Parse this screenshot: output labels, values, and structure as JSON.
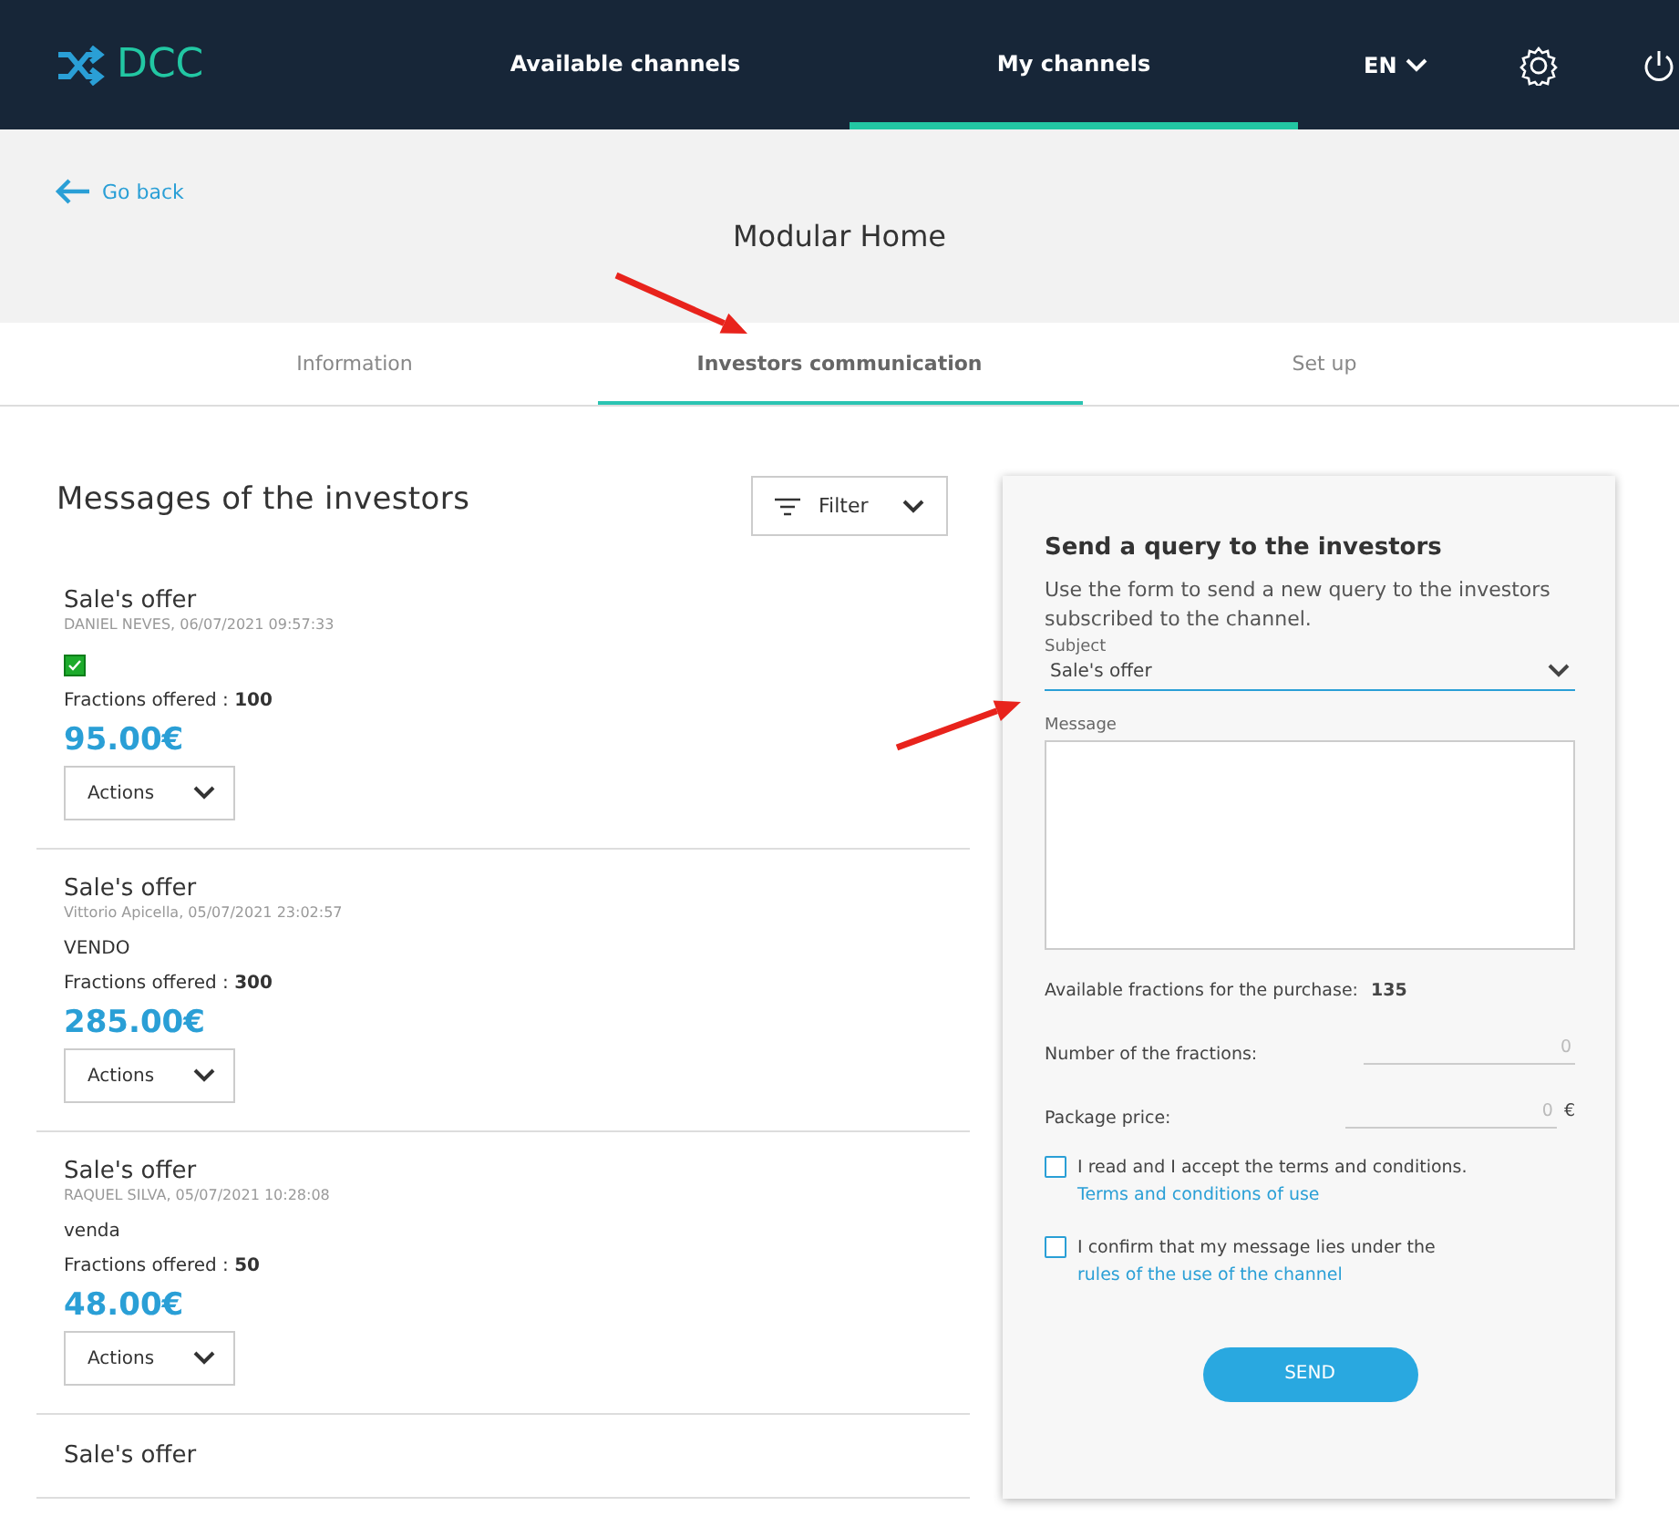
{
  "header": {
    "logo": "DCC",
    "nav": [
      {
        "label": "Available channels",
        "selected": false
      },
      {
        "label": "My channels",
        "selected": true
      }
    ],
    "language": "EN"
  },
  "page": {
    "back": "Go back",
    "title": "Modular Home"
  },
  "tabs": [
    {
      "label": "Information",
      "selected": false
    },
    {
      "label": "Investors communication",
      "selected": true
    },
    {
      "label": "Set up",
      "selected": false
    }
  ],
  "messages": {
    "title": "Messages of the investors",
    "filter": "Filter",
    "items": [
      {
        "title": "Sale's offer",
        "meta": "DANIEL NEVES, 06/07/2021 09:57:33",
        "kind": "check",
        "checked": true,
        "fractions_label": "Fractions offered :",
        "fractions": "100",
        "price": "95.00€",
        "action": "Actions"
      },
      {
        "title": "Sale's offer",
        "meta": "Vittorio Apicella, 05/07/2021 23:02:57",
        "kind": "text",
        "body": "VENDO",
        "fractions_label": "Fractions offered :",
        "fractions": "300",
        "price": "285.00€",
        "action": "Actions"
      },
      {
        "title": "Sale's offer",
        "meta": "RAQUEL SILVA, 05/07/2021 10:28:08",
        "kind": "text",
        "body": "venda",
        "fractions_label": "Fractions offered :",
        "fractions": "50",
        "price": "48.00€",
        "action": "Actions"
      },
      {
        "title": "Sale's offer",
        "kind": "partial"
      }
    ]
  },
  "query": {
    "title": "Send a query to the investors",
    "intro": "Use the form to send a new query to the investors subscribed to the channel.",
    "subject_label": "Subject",
    "subject": "Sale's offer",
    "message_label": "Message",
    "available_label": "Available fractions for the purchase:",
    "available": "135",
    "number_label": "Number of the fractions:",
    "number_placeholder": "0",
    "price_label": "Package price:",
    "price_placeholder": "0",
    "currency": "€",
    "checks": [
      {
        "text": "I read and I accept the terms and conditions.",
        "link": "Terms and conditions of use",
        "checked": false
      },
      {
        "text": "I confirm that my message lies under the",
        "link": "rules of the use of the channel",
        "checked": false
      }
    ],
    "send": "SEND"
  },
  "annotations": [
    {
      "kind": "arrow"
    },
    {
      "kind": "arrow"
    }
  ]
}
